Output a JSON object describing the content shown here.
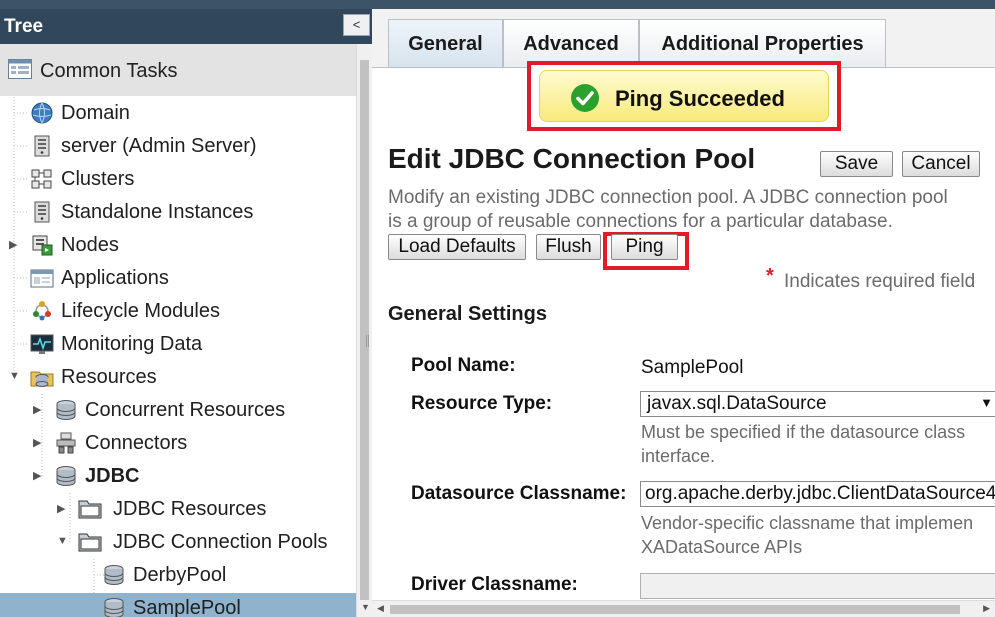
{
  "tree": {
    "header": "Tree",
    "collapse_glyph": "<",
    "common_tasks": "Common Tasks",
    "items": [
      {
        "label": "Domain",
        "icon": "globe-icon"
      },
      {
        "label": "server (Admin Server)",
        "icon": "server-icon"
      },
      {
        "label": "Clusters",
        "icon": "cluster-icon"
      },
      {
        "label": "Standalone Instances",
        "icon": "server-icon"
      },
      {
        "label": "Nodes",
        "icon": "nodes-icon"
      },
      {
        "label": "Applications",
        "icon": "window-icon"
      },
      {
        "label": "Lifecycle Modules",
        "icon": "lifecycle-icon"
      },
      {
        "label": "Monitoring Data",
        "icon": "monitor-icon"
      },
      {
        "label": "Resources",
        "icon": "resources-icon"
      },
      {
        "label": "Concurrent Resources",
        "icon": "database-icon"
      },
      {
        "label": "Connectors",
        "icon": "connector-icon"
      },
      {
        "label": "JDBC",
        "icon": "database-icon"
      },
      {
        "label": "JDBC Resources",
        "icon": "folder-icon"
      },
      {
        "label": "JDBC Connection Pools",
        "icon": "folder-icon"
      },
      {
        "label": "DerbyPool",
        "icon": "database-icon"
      },
      {
        "label": "SamplePool",
        "icon": "database-icon",
        "selected": true
      }
    ]
  },
  "tabs": [
    {
      "label": "General",
      "active": true
    },
    {
      "label": "Advanced"
    },
    {
      "label": "Additional Properties"
    }
  ],
  "ping_message": "Ping Succeeded",
  "page": {
    "title": "Edit JDBC Connection Pool",
    "save_label": "Save",
    "cancel_label": "Cancel",
    "description_line1": "Modify an existing JDBC connection pool. A JDBC connection pool",
    "description_line2": "is a group of reusable connections for a particular database.",
    "load_defaults_label": "Load Defaults",
    "flush_label": "Flush",
    "ping_label": "Ping",
    "required_star": "*",
    "required_text": "Indicates required field",
    "section_title": "General Settings"
  },
  "form": {
    "pool_name_label": "Pool Name:",
    "pool_name_value": "SamplePool",
    "resource_type_label": "Resource Type:",
    "resource_type_value": "javax.sql.DataSource",
    "resource_type_help1": "Must be specified if the datasource class",
    "resource_type_help2": "interface.",
    "datasource_label": "Datasource Classname:",
    "datasource_value": "org.apache.derby.jdbc.ClientDataSource4",
    "datasource_help1": "Vendor-specific classname that implemen",
    "datasource_help2": "XADataSource APIs",
    "driver_label": "Driver Classname:",
    "driver_value": ""
  },
  "colors": {
    "header_bg": "#31475b",
    "selected_bg": "#8fb3cd",
    "highlight_red": "#e11b2a",
    "success_green": "#2ca02c"
  }
}
